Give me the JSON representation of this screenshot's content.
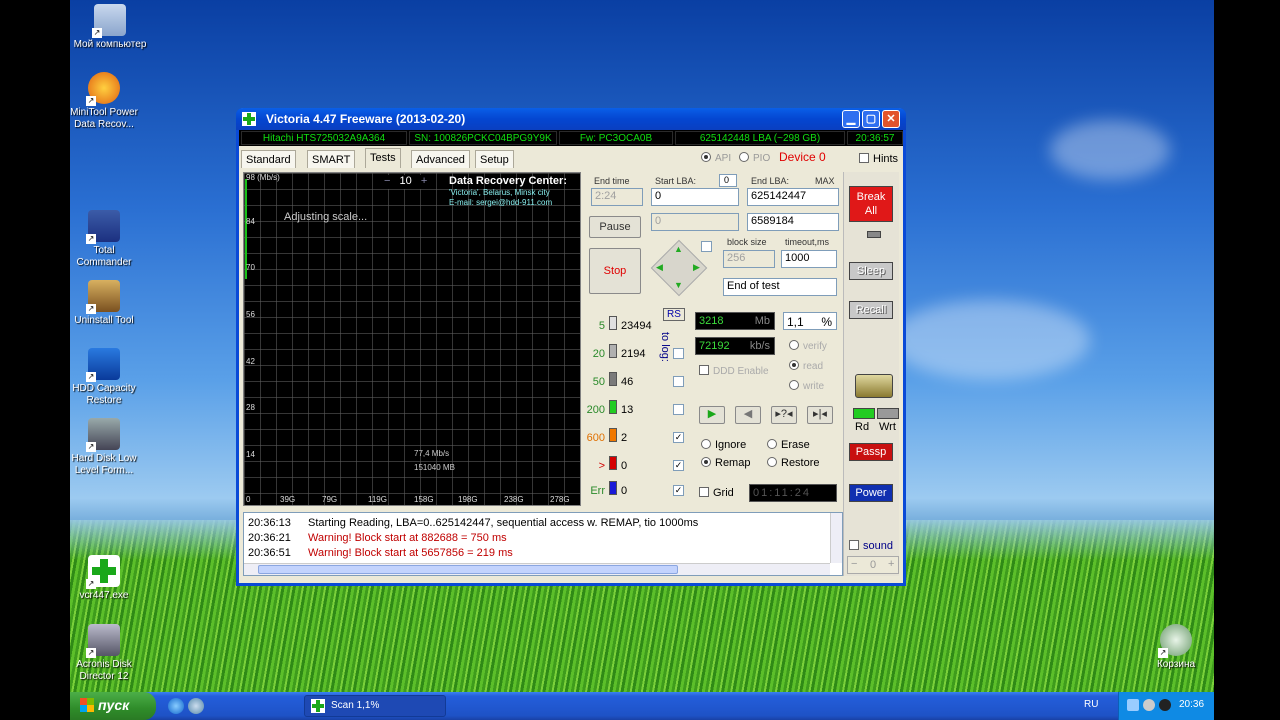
{
  "desktop_icons": [
    {
      "label": "Мой компьютер"
    },
    {
      "label": "MiniTool Power Data Recov..."
    },
    {
      "label": "Total Commander"
    },
    {
      "label": "Uninstall Tool"
    },
    {
      "label": "HDD Capacity Restore"
    },
    {
      "label": "Hard Disk Low Level Form..."
    },
    {
      "label": "vcr447.exe"
    },
    {
      "label": "Acronis Disk Director 12"
    },
    {
      "label": "Корзина"
    }
  ],
  "window": {
    "title": "Victoria 4.47  Freeware (2013-02-20)",
    "drive_model": "Hitachi HTS725032A9A364",
    "serial": "SN: 100826PCKC04BPG9Y9K",
    "firmware": "Fw: PC3OCA0B",
    "lba_info": "625142448 LBA (~298 GB)",
    "clock": "20:36:57"
  },
  "tabs": [
    "Standard",
    "SMART",
    "Tests",
    "Advanced",
    "Setup"
  ],
  "device": {
    "api_label": "API",
    "pio_label": "PIO",
    "device_label": "Device 0",
    "hints_label": "Hints"
  },
  "graph": {
    "unit": "98 (Mb/s)",
    "scale_value": "10",
    "status": "Adjusting scale...",
    "drc_title": "Data Recovery Center:",
    "drc_line2": "'Victoria', Belarus, Minsk city",
    "drc_line3": "E-mail: sergei@hdd-911.com",
    "speed": "77,4 Mb/s",
    "mb": "151040 MB",
    "y_ticks": [
      "84",
      "70",
      "56",
      "42",
      "28",
      "14"
    ],
    "x_ticks": [
      "0",
      "39G",
      "79G",
      "119G",
      "158G",
      "198G",
      "238G",
      "278G"
    ]
  },
  "controls": {
    "end_time_label": "End time",
    "end_time_value": "2:24",
    "start_lba_label": "Start LBA:",
    "start_lba_zero": "0",
    "start_lba_value": "0",
    "start_lba_cur": "0",
    "end_lba_label": "End LBA:",
    "end_lba_max": "MAX",
    "end_lba_value": "625142447",
    "end_lba_cur": "6589184",
    "pause": "Pause",
    "stop": "Stop",
    "block_size_label": "block size",
    "block_size_value": "256",
    "timeout_label": "timeout,ms",
    "timeout_value": "1000",
    "end_of_test": "End of test",
    "rs": "RS",
    "to_log": "to log:",
    "mb_value": "3218",
    "mb_unit": "Mb",
    "percent_value": "1,1",
    "percent_unit": "%",
    "kbs_value": "72192",
    "kbs_unit": "kb/s",
    "verify": "verify",
    "read": "read",
    "write": "write",
    "ddd_enable": "DDD Enable",
    "ignore": "Ignore",
    "erase": "Erase",
    "remap": "Remap",
    "restore": "Restore",
    "grid": "Grid",
    "timer": "01:11:24"
  },
  "block_rows": [
    {
      "label": "5",
      "value": "23494",
      "color": "#e0e0e0",
      "checked": false
    },
    {
      "label": "20",
      "value": "2194",
      "color": "#b0b0b0",
      "checked": false
    },
    {
      "label": "50",
      "value": "46",
      "color": "#7a7a7a",
      "checked": false
    },
    {
      "label": "200",
      "value": "13",
      "color": "#22cc22",
      "checked": false
    },
    {
      "label": "600",
      "value": "2",
      "color": "#f07800",
      "checked": true
    },
    {
      "label": ">",
      "value": "0",
      "color": "#d40000",
      "checked": true
    },
    {
      "label": "Err",
      "value": "0",
      "color": "#1a1ad8",
      "checked": true
    }
  ],
  "side": {
    "break_all": "Break All",
    "sleep": "Sleep",
    "recall": "Recall",
    "rd": "Rd",
    "wrt": "Wrt",
    "passp": "Passp",
    "power": "Power",
    "sound": "sound",
    "sound_value": "0"
  },
  "log": [
    {
      "time": "20:36:13",
      "text": "Starting Reading, LBA=0..625142447, sequential access w. REMAP, tio 1000ms",
      "color": "#000000"
    },
    {
      "time": "20:36:21",
      "text": "Warning! Block start at 882688 = 750 ms",
      "color": "#c00000"
    },
    {
      "time": "20:36:51",
      "text": "Warning! Block start at 5657856 = 219 ms",
      "color": "#c00000"
    }
  ],
  "taskbar": {
    "start": "пуск",
    "task": "Scan 1,1%",
    "lang": "RU",
    "time": "20:36"
  }
}
